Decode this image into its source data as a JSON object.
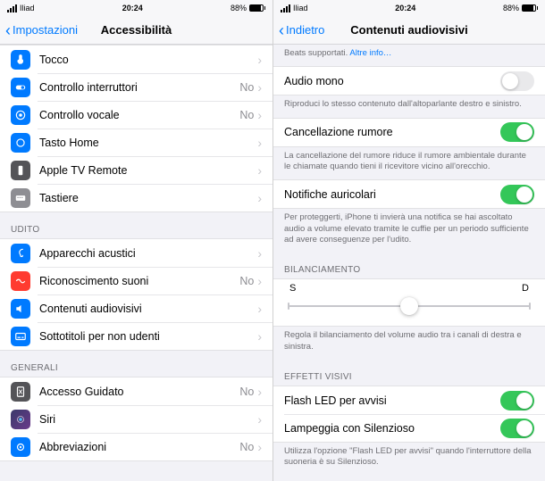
{
  "status": {
    "carrier": "Iliad",
    "time": "20:24",
    "battery": "88%"
  },
  "left": {
    "back": "Impostazioni",
    "title": "Accessibilità",
    "groups": [
      {
        "header": null,
        "rows": [
          {
            "label": "Tocco",
            "icon": "touch",
            "value": null
          },
          {
            "label": "Controllo interruttori",
            "icon": "switch",
            "value": "No"
          },
          {
            "label": "Controllo vocale",
            "icon": "voice",
            "value": "No"
          },
          {
            "label": "Tasto Home",
            "icon": "home",
            "value": null
          },
          {
            "label": "Apple TV Remote",
            "icon": "remote",
            "value": null
          },
          {
            "label": "Tastiere",
            "icon": "keyboard",
            "value": null
          }
        ]
      },
      {
        "header": "UDITO",
        "rows": [
          {
            "label": "Apparecchi acustici",
            "icon": "hearing",
            "value": null
          },
          {
            "label": "Riconoscimento suoni",
            "icon": "sound",
            "value": "No"
          },
          {
            "label": "Contenuti audiovisivi",
            "icon": "av",
            "value": null
          },
          {
            "label": "Sottotitoli per non udenti",
            "icon": "captions",
            "value": null
          }
        ]
      },
      {
        "header": "GENERALI",
        "rows": [
          {
            "label": "Accesso Guidato",
            "icon": "guided",
            "value": "No"
          },
          {
            "label": "Siri",
            "icon": "siri",
            "value": null
          },
          {
            "label": "Abbreviazioni",
            "icon": "shortcut",
            "value": "No"
          }
        ]
      }
    ]
  },
  "right": {
    "back": "Indietro",
    "title": "Contenuti audiovisivi",
    "headphone_footer": "Beats supportati.",
    "headphone_link": "Altre info…",
    "mono": {
      "label": "Audio mono",
      "on": false,
      "footer": "Riproduci lo stesso contenuto dall'altoparlante destro e sinistro."
    },
    "noise": {
      "label": "Cancellazione rumore",
      "on": true,
      "footer": "La cancellazione del rumore riduce il rumore ambientale durante le chiamate quando tieni il ricevitore vicino all'orecchio."
    },
    "notif": {
      "label": "Notifiche auricolari",
      "on": true,
      "footer": "Per proteggerti, iPhone ti invierà una notifica se hai ascoltato audio a volume elevato tramite le cuffie per un periodo sufficiente ad avere conseguenze per l'udito."
    },
    "balance": {
      "header": "BILANCIAMENTO",
      "left": "S",
      "right": "D",
      "footer": "Regola il bilanciamento del volume audio tra i canali di destra e sinistra."
    },
    "visual": {
      "header": "EFFETTI VISIVI",
      "flash": {
        "label": "Flash LED per avvisi",
        "on": true
      },
      "silent": {
        "label": "Lampeggia con Silenzioso",
        "on": true
      },
      "footer": "Utilizza l'opzione \"Flash LED per avvisi\" quando l'interruttore della suoneria è su Silenzioso."
    }
  }
}
